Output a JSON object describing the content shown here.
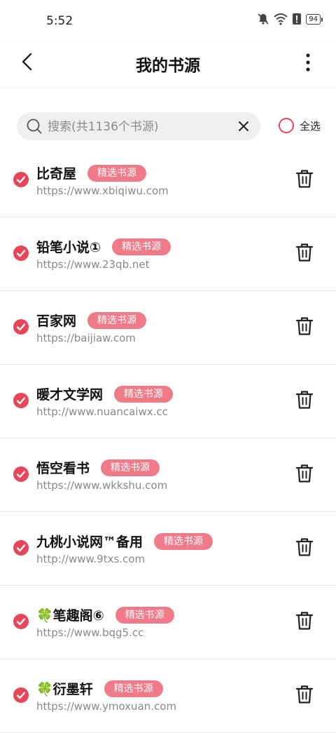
{
  "status_bar": {
    "time": "5:52",
    "battery": "94"
  },
  "header": {
    "title": "我的书源"
  },
  "search": {
    "placeholder": "搜索(共1136个书源)",
    "value": ""
  },
  "select_all": {
    "label": "全选"
  },
  "colors": {
    "accent": "#e94558",
    "badge": "#f07a88"
  },
  "sources": [
    {
      "name": "比奇屋",
      "badge": "精选书源",
      "url": "https://www.xbiqiwu.com",
      "selected": true
    },
    {
      "name": "铅笔小说①",
      "badge": "精选书源",
      "url": "https://www.23qb.net",
      "selected": true
    },
    {
      "name": "百家网",
      "badge": "精选书源",
      "url": "https://baijiaw.com",
      "selected": true
    },
    {
      "name": "暖才文学网",
      "badge": "精选书源",
      "url": "http://www.nuancaiwx.cc",
      "selected": true
    },
    {
      "name": "悟空看书",
      "badge": "精选书源",
      "url": "https://www.wkkshu.com",
      "selected": true
    },
    {
      "name": "九桃小说网™备用",
      "badge": "精选书源",
      "url": "http://www.9txs.com",
      "selected": true
    },
    {
      "name": "🍀笔趣阁⑥",
      "badge": "精选书源",
      "url": "https://www.bqg5.cc",
      "selected": true
    },
    {
      "name": "🍀衍墨轩",
      "badge": "精选书源",
      "url": "https://www.ymoxuan.com",
      "selected": true
    }
  ]
}
